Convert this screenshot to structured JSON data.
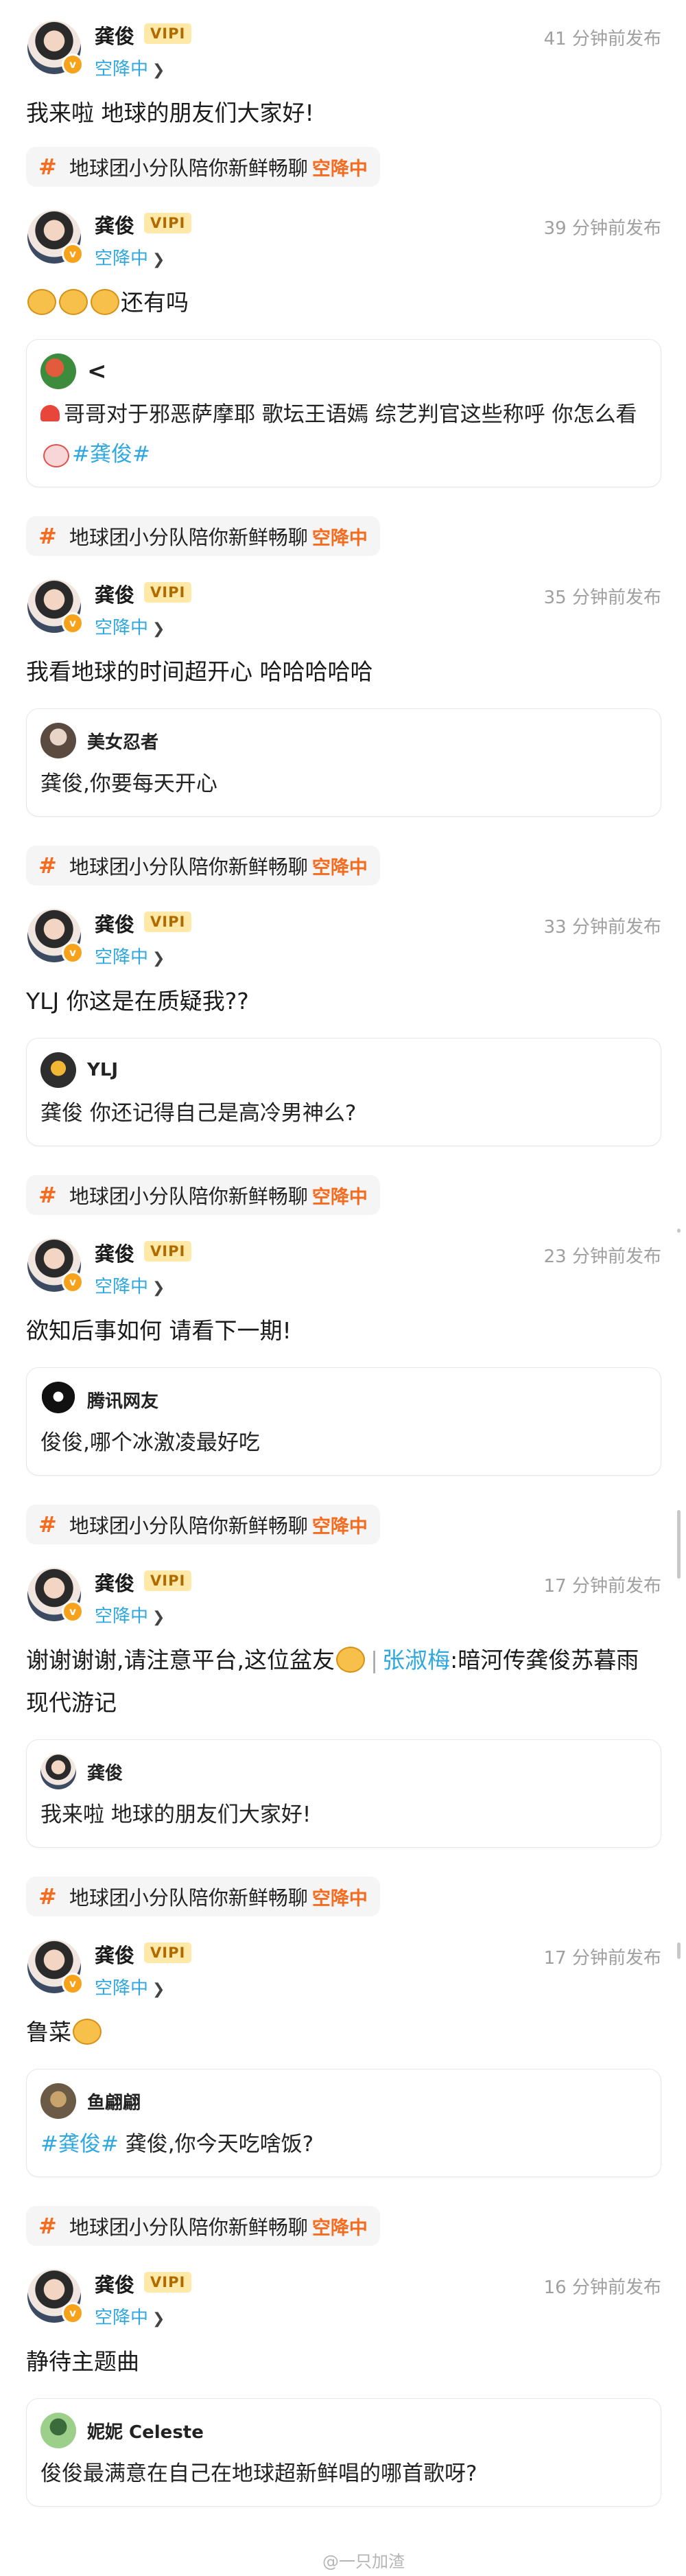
{
  "topic": {
    "text": "地球团小分队陪你新鲜畅聊",
    "status": "空降中"
  },
  "posts": [
    {
      "user": "龚俊",
      "vip": "VIPⅠ",
      "time": "41 分钟前发布",
      "location": "空降中",
      "text": "我来啦 地球的朋友们大家好!"
    },
    {
      "user": "龚俊",
      "vip": "VIPⅠ",
      "time": "39 分钟前发布",
      "location": "空降中",
      "text": "还有吗",
      "quote": {
        "author": "<",
        "text_a": "哥哥对于邪恶萨摩耶 歌坛王语嫣 综艺判官这些称呼 你怎么看",
        "tag": "#龚俊#"
      }
    },
    {
      "user": "龚俊",
      "vip": "VIPⅠ",
      "time": "35 分钟前发布",
      "location": "空降中",
      "text": "我看地球的时间超开心 哈哈哈哈哈",
      "quote": {
        "author": "美女忍者",
        "text": "龚俊,你要每天开心"
      }
    },
    {
      "user": "龚俊",
      "vip": "VIPⅠ",
      "time": "33 分钟前发布",
      "location": "空降中",
      "text": "YLJ 你这是在质疑我??",
      "quote": {
        "author": "YLJ",
        "text": "龚俊 你还记得自己是高冷男神么?"
      }
    },
    {
      "user": "龚俊",
      "vip": "VIPⅠ",
      "time": "23 分钟前发布",
      "location": "空降中",
      "text": "欲知后事如何 请看下一期!",
      "quote": {
        "author": "腾讯网友",
        "text": "俊俊,哪个冰激凌最好吃"
      }
    },
    {
      "user": "龚俊",
      "vip": "VIPⅠ",
      "time": "17 分钟前发布",
      "location": "空降中",
      "text_a": "谢谢谢谢,请注意平台,这位盆友",
      "divider": "|",
      "mention": "张淑梅",
      "text_b": ":暗河传龚俊苏暮雨现代游记",
      "quote": {
        "author": "龚俊",
        "text": "我来啦 地球的朋友们大家好!"
      }
    },
    {
      "user": "龚俊",
      "vip": "VIPⅠ",
      "time": "17 分钟前发布",
      "location": "空降中",
      "text": "鲁菜",
      "quote": {
        "author": "鱼翩翩",
        "tag": "#龚俊#",
        "text": " 龚俊,你今天吃啥饭?"
      }
    },
    {
      "user": "龚俊",
      "vip": "VIPⅠ",
      "time": "16 分钟前发布",
      "location": "空降中",
      "text": "静待主题曲",
      "quote": {
        "author": "妮妮 Celeste",
        "text": "俊俊最满意在自己在地球超新鲜唱的哪首歌呀?"
      }
    }
  ],
  "watermark": "@一只加渣",
  "icons": [
    "verified-icon",
    "chevron-right-icon",
    "hash-icon",
    "back-icon"
  ],
  "colors": {
    "accent_orange": "#f56b20",
    "link_blue": "#2fa8e0",
    "vip_gold": "#ffe9a8",
    "verified_gold": "#f7a21b"
  }
}
